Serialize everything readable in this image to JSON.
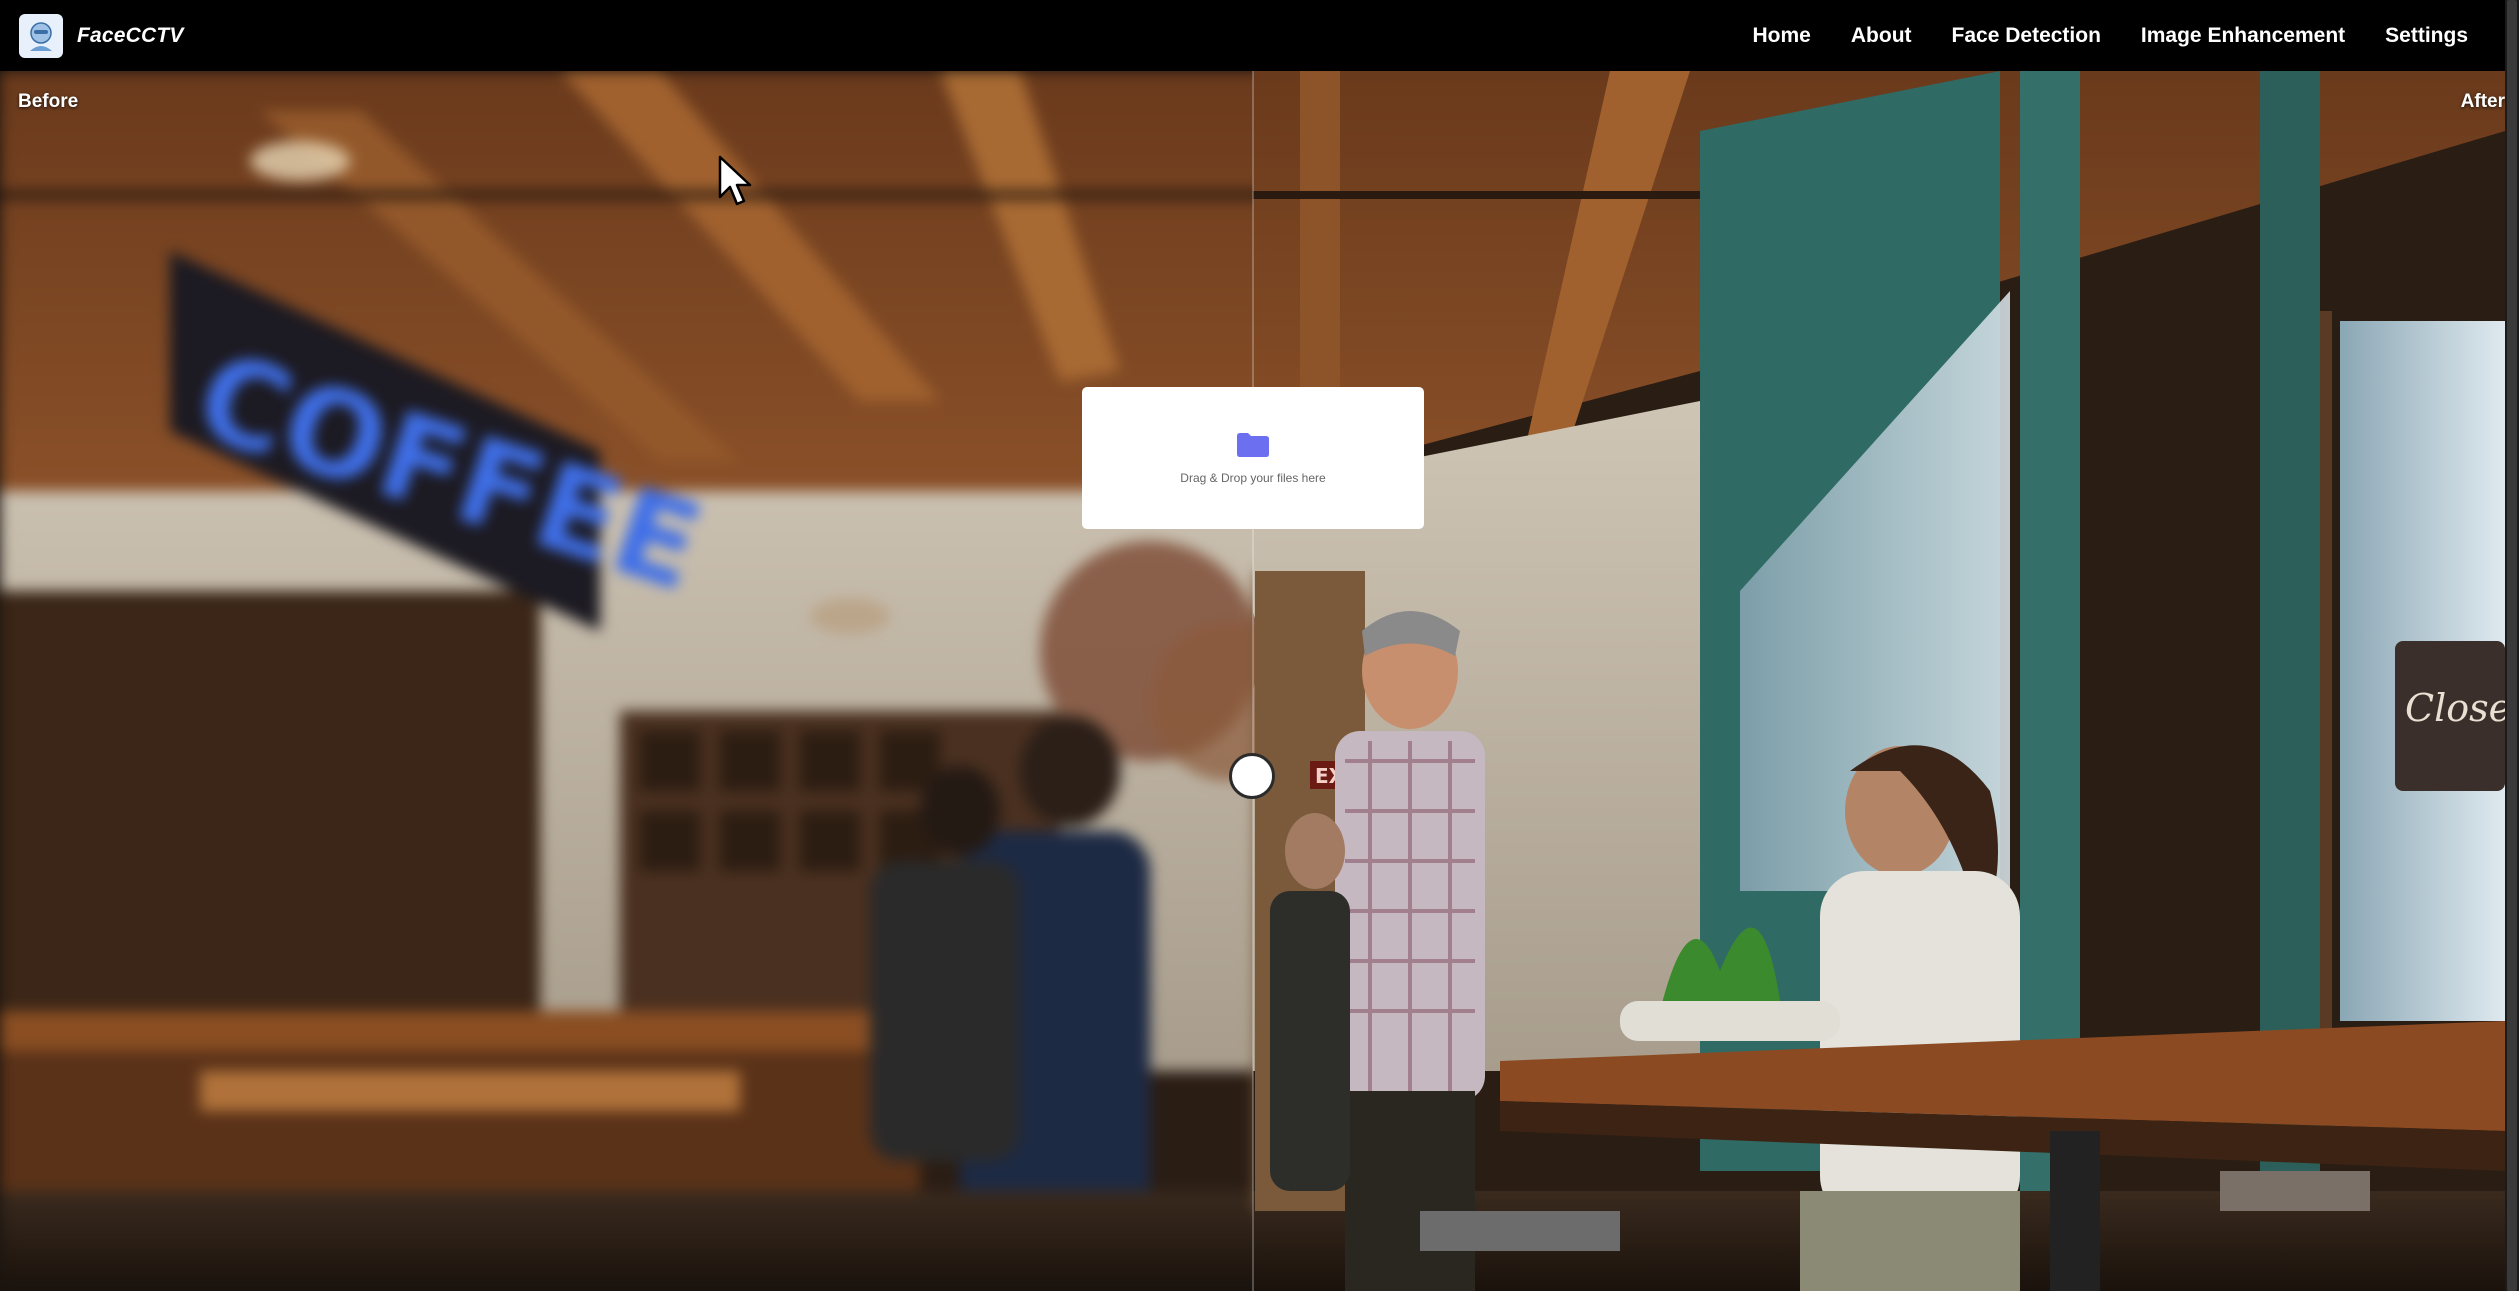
{
  "app": {
    "name": "FaceCCTV"
  },
  "nav": {
    "links": [
      "Home",
      "About",
      "Face Detection",
      "Image Enhancement",
      "Settings"
    ]
  },
  "compare": {
    "before_label": "Before",
    "after_label": "After",
    "split_fraction": 0.5
  },
  "upload": {
    "prompt": "Drag & Drop your files here",
    "icon": "folder-icon"
  },
  "scene": {
    "sign_text": "COFFEE",
    "window_sign": "Closed",
    "exit_sign": "EXIT"
  },
  "colors": {
    "navbar_bg": "#000000",
    "folder_icon": "#6b6ff0"
  }
}
